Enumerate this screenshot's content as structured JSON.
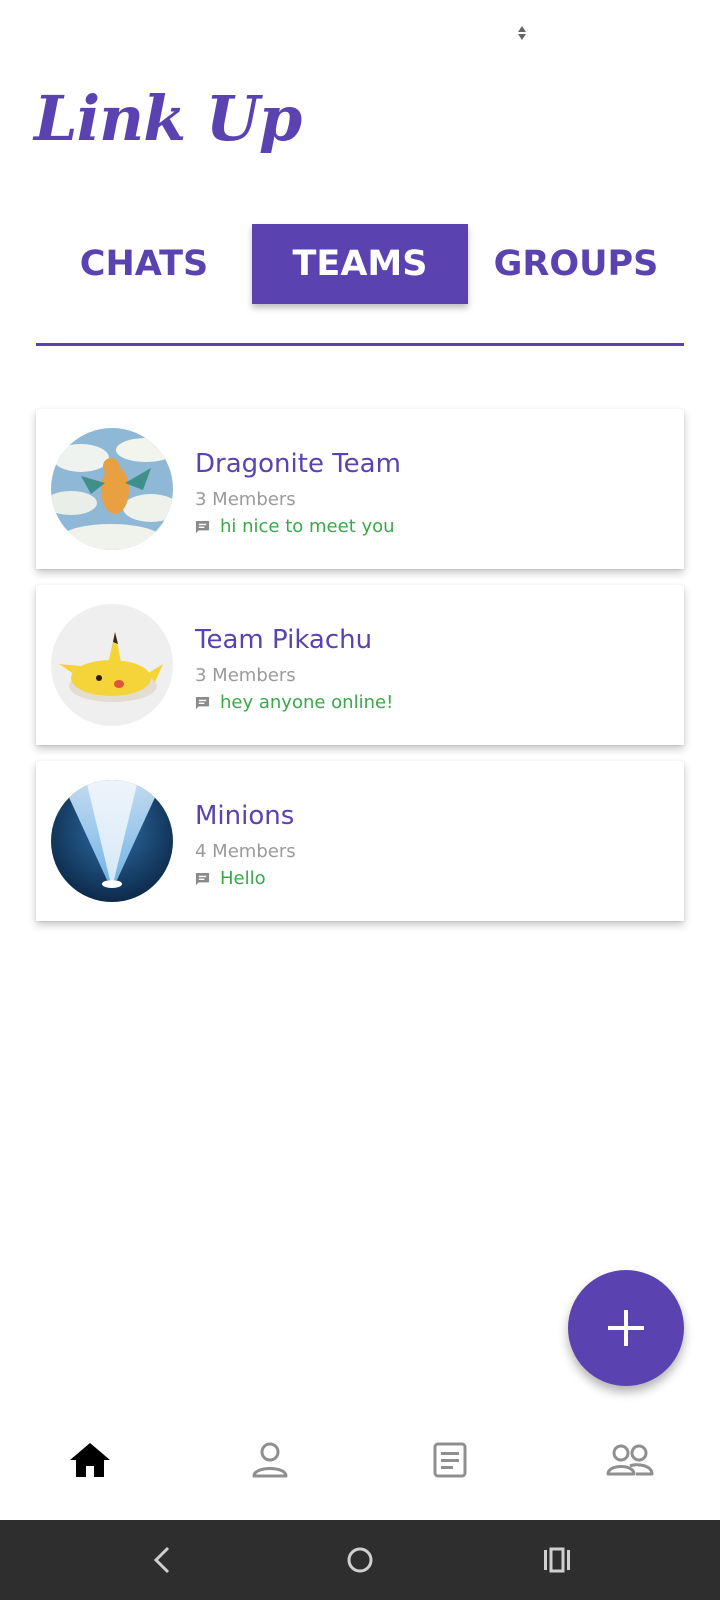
{
  "app": {
    "title": "Link Up",
    "brand_color": "#5a43b0",
    "message_color": "#3aa84a",
    "members_color": "#9a9a9a"
  },
  "tabs": [
    {
      "label": "CHATS",
      "active": false
    },
    {
      "label": "TEAMS",
      "active": true
    },
    {
      "label": "GROUPS",
      "active": false
    }
  ],
  "teams": [
    {
      "name": "Dragonite Team",
      "members": "3 Members",
      "last_message": "hi nice to meet you",
      "avatar": "dragonite-avatar",
      "message_icon": "message-icon"
    },
    {
      "name": "Team Pikachu",
      "members": "3 Members",
      "last_message": "hey anyone online!",
      "avatar": "pikachu-avatar",
      "message_icon": "message-icon"
    },
    {
      "name": "Minions",
      "members": "4 Members",
      "last_message": "Hello",
      "avatar": "spotlight-avatar",
      "message_icon": "message-icon"
    }
  ],
  "fab": {
    "icon": "plus-icon"
  },
  "bottom_nav": [
    {
      "icon": "home-icon",
      "active": true
    },
    {
      "icon": "profile-icon",
      "active": false
    },
    {
      "icon": "document-icon",
      "active": false
    },
    {
      "icon": "people-icon",
      "active": false
    }
  ],
  "system_nav": [
    {
      "icon": "back-icon"
    },
    {
      "icon": "home-circle-icon"
    },
    {
      "icon": "recent-apps-icon"
    }
  ]
}
